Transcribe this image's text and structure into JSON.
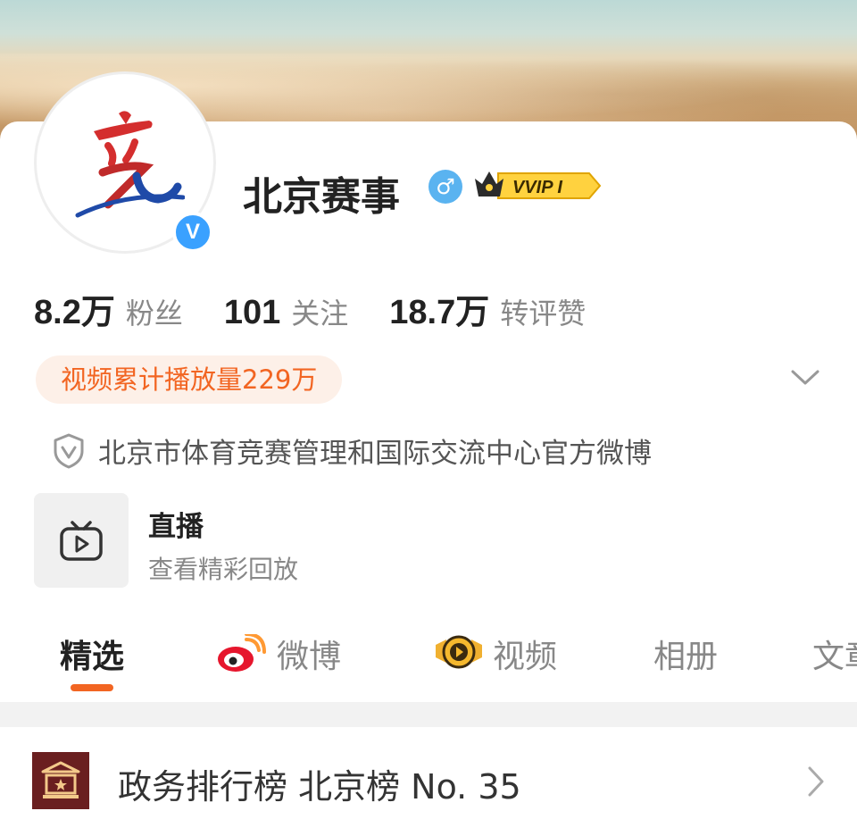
{
  "profile": {
    "name": "北京赛事",
    "gender_symbol": "♂",
    "vip_label": "VVIP I",
    "verified_mark": "V",
    "avatar_logo_char": "竞"
  },
  "stats": [
    {
      "value": "8.2万",
      "label": "粉丝"
    },
    {
      "value": "101",
      "label": "关注"
    },
    {
      "value": "18.7万",
      "label": "转评赞"
    }
  ],
  "video_pill": "视频累计播放量229万",
  "verification": "北京市体育竞赛管理和国际交流中心官方微博",
  "live": {
    "title": "直播",
    "subtitle": "查看精彩回放"
  },
  "tabs": [
    {
      "label": "精选",
      "icon": null
    },
    {
      "label": "微博",
      "icon": "weibo-logo-icon"
    },
    {
      "label": "视频",
      "icon": "video-badge-icon"
    },
    {
      "label": "相册",
      "icon": null
    },
    {
      "label": "文章",
      "icon": null
    }
  ],
  "rank": {
    "text": "政务排行榜 北京榜 No. 35"
  },
  "colors": {
    "accent": "#f26522",
    "verified_blue": "#3aa1ff",
    "rank_icon_bg": "#6a1f20"
  }
}
